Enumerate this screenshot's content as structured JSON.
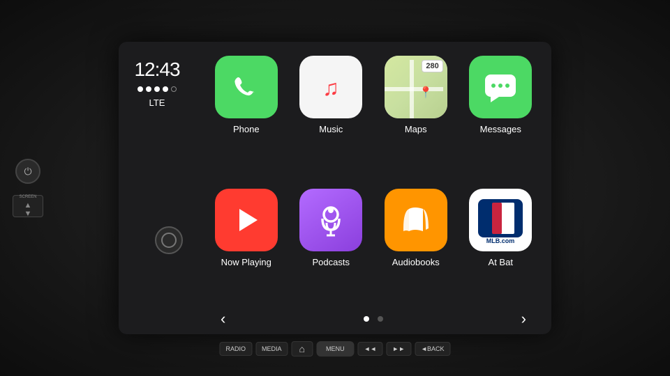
{
  "display": {
    "time": "12:43",
    "signal_label": "LTE",
    "signal_dots": [
      true,
      true,
      true,
      true,
      false
    ],
    "page_indicators": [
      true,
      false
    ]
  },
  "apps": {
    "row1": [
      {
        "id": "phone",
        "label": "Phone",
        "icon_type": "phone"
      },
      {
        "id": "music",
        "label": "Music",
        "icon_type": "music"
      },
      {
        "id": "maps",
        "label": "Maps",
        "icon_type": "maps"
      },
      {
        "id": "messages",
        "label": "Messages",
        "icon_type": "messages"
      }
    ],
    "row2": [
      {
        "id": "nowplaying",
        "label": "Now Playing",
        "icon_type": "nowplaying"
      },
      {
        "id": "podcasts",
        "label": "Podcasts",
        "icon_type": "podcasts"
      },
      {
        "id": "audiobooks",
        "label": "Audiobooks",
        "icon_type": "audiobooks"
      },
      {
        "id": "atbat",
        "label": "At Bat",
        "icon_type": "atbat"
      }
    ]
  },
  "nav": {
    "left_arrow": "‹",
    "right_arrow": "›"
  },
  "bottom_bar": {
    "buttons": [
      "RADIO",
      "MEDIA",
      "⌂",
      "◄◄",
      "►► ",
      "◄BACK",
      "MENU"
    ]
  },
  "left_controls": {
    "power_icon": "⏻",
    "screen_label": "SCREEN"
  }
}
